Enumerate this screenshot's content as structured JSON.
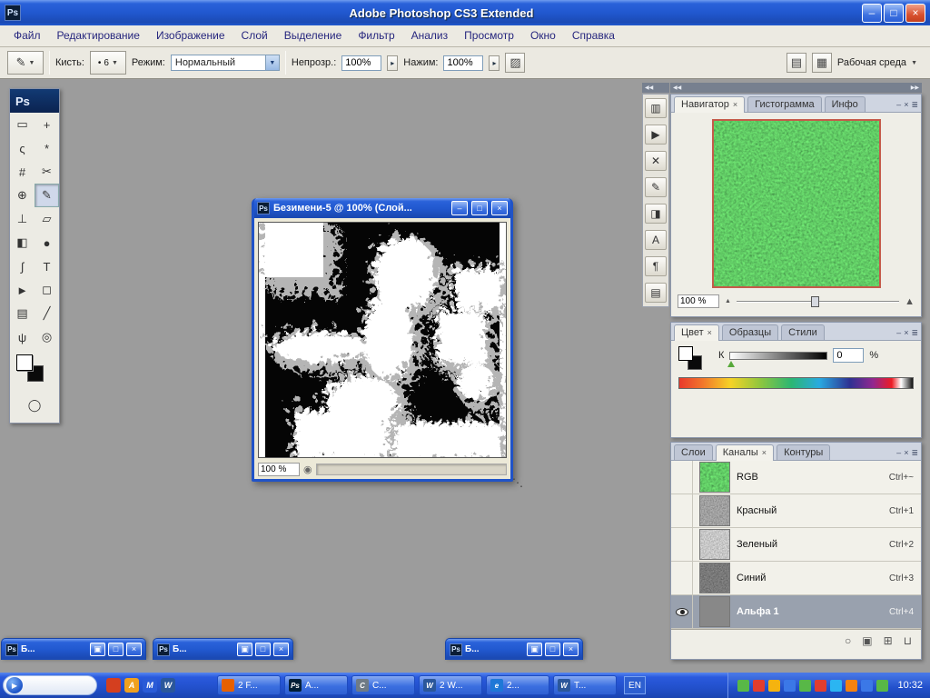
{
  "colors": {
    "titlebar_blue": "#2158cf",
    "taskbar_blue": "#2a5ade",
    "workspace_gray": "#9c9c9c",
    "selected_row_gray": "#99a1ae",
    "navigator_proxy_red": "#c55a4a"
  },
  "icons": {
    "minimize": "‒",
    "maximize": "□",
    "restore": "▣",
    "close": "×",
    "menu": "≣",
    "dropdown": "▼",
    "small_arrow": "▸",
    "chevrons_left": "◀◀",
    "chevrons_right": "▶▶",
    "mountain": "▲",
    "play": "▶",
    "dot": "◉",
    "grip": "⋱"
  },
  "titlebar": {
    "app_icon": "Ps",
    "title": "Adobe Photoshop CS3 Extended"
  },
  "menubar": {
    "items": [
      "Файл",
      "Редактирование",
      "Изображение",
      "Слой",
      "Выделение",
      "Фильтр",
      "Анализ",
      "Просмотр",
      "Окно",
      "Справка"
    ]
  },
  "optionsbar": {
    "tool_icon": "✎",
    "brush_label": "Кисть:",
    "brush_dot": "•",
    "brush_size": "6",
    "mode_label": "Режим:",
    "mode_value": "Нормальный",
    "opacity_label": "Непрозр.:",
    "opacity_value": "100%",
    "flow_label": "Нажим:",
    "flow_value": "100%",
    "airbrush_icon": "▨",
    "palette_icon_1": "▤",
    "palette_icon_2": "▦",
    "workspace_label": "Рабочая среда"
  },
  "toolbox": {
    "header": "Ps",
    "tools": [
      {
        "name": "rectangular-marquee",
        "glyph": "▭"
      },
      {
        "name": "move",
        "glyph": "+"
      },
      {
        "name": "lasso",
        "glyph": "ς"
      },
      {
        "name": "magic-wand",
        "glyph": "*"
      },
      {
        "name": "crop",
        "glyph": "#"
      },
      {
        "name": "slice",
        "glyph": "✂"
      },
      {
        "name": "healing-brush",
        "glyph": "⊕"
      },
      {
        "name": "brush",
        "glyph": "✎"
      },
      {
        "name": "clone-stamp",
        "glyph": "⊥"
      },
      {
        "name": "eraser",
        "glyph": "▱"
      },
      {
        "name": "gradient",
        "glyph": "◧"
      },
      {
        "name": "blur",
        "glyph": "●"
      },
      {
        "name": "pen",
        "glyph": "∫"
      },
      {
        "name": "type",
        "glyph": "T"
      },
      {
        "name": "path-selection",
        "glyph": "►"
      },
      {
        "name": "shape",
        "glyph": "◻"
      },
      {
        "name": "notes",
        "glyph": "▤"
      },
      {
        "name": "eyedropper",
        "glyph": "╱"
      },
      {
        "name": "hand",
        "glyph": "ψ"
      },
      {
        "name": "zoom",
        "glyph": "◎"
      }
    ],
    "quick_mask_glyph": "◯"
  },
  "dock_strip": {
    "icons": [
      {
        "name": "panel-grid",
        "glyph": "▥"
      },
      {
        "name": "panel-play",
        "glyph": "▶"
      },
      {
        "name": "panel-tools",
        "glyph": "✕"
      },
      {
        "name": "panel-brush",
        "glyph": "✎"
      },
      {
        "name": "panel-gradient",
        "glyph": "◨"
      },
      {
        "name": "panel-character",
        "glyph": "А"
      },
      {
        "name": "panel-paragraph",
        "glyph": "¶"
      },
      {
        "name": "panel-notes",
        "glyph": "▤"
      }
    ]
  },
  "document": {
    "icon": "Ps",
    "title": "Безимени-5 @ 100% (Слой...",
    "zoom_value": "100 %"
  },
  "navigator": {
    "tabs": [
      "Навигатор",
      "Гистограмма",
      "Инфо"
    ],
    "zoom_value": "100 %"
  },
  "color": {
    "tabs": [
      "Цвет",
      "Образцы",
      "Стили"
    ],
    "channel_label": "К",
    "value": "0",
    "unit": "%"
  },
  "channels": {
    "tabs": [
      "Слои",
      "Каналы",
      "Контуры"
    ],
    "rows": [
      {
        "name": "RGB",
        "shortcut": "Ctrl+~"
      },
      {
        "name": "Красный",
        "shortcut": "Ctrl+1"
      },
      {
        "name": "Зеленый",
        "shortcut": "Ctrl+2"
      },
      {
        "name": "Синий",
        "shortcut": "Ctrl+3"
      },
      {
        "name": "Альфа 1",
        "shortcut": "Ctrl+4"
      }
    ],
    "footer_icons": [
      {
        "name": "load-selection",
        "glyph": "○"
      },
      {
        "name": "save-selection",
        "glyph": "▣"
      },
      {
        "name": "new-channel",
        "glyph": "⊞"
      },
      {
        "name": "delete-channel",
        "glyph": "⊔"
      }
    ]
  },
  "minimized_windows": [
    {
      "icon": "Ps",
      "title": "Б..."
    },
    {
      "icon": "Ps",
      "title": "Б..."
    },
    {
      "icon": "Ps",
      "title": "Б..."
    }
  ],
  "taskbar": {
    "quick_launch": [
      {
        "name": "quick-launch-1",
        "color": "#d43f1f",
        "label": ""
      },
      {
        "name": "quick-launch-2",
        "color": "#f0a11e",
        "label": "A"
      },
      {
        "name": "quick-launch-3",
        "color": "#2a5bd7",
        "label": "M"
      },
      {
        "name": "quick-launch-4",
        "color": "#2b579a",
        "label": "W"
      }
    ],
    "tasks": [
      {
        "label": "2 F...",
        "icon_color": "#e66000",
        "icon_text": ""
      },
      {
        "label": "A...",
        "icon_color": "#001e36",
        "icon_text": "Ps"
      },
      {
        "label": "C...",
        "icon_color": "#6f7b86",
        "icon_text": "C"
      },
      {
        "label": "2 W...",
        "icon_color": "#2b579a",
        "icon_text": "W"
      },
      {
        "label": "2...",
        "icon_color": "#1e78d7",
        "icon_text": "e"
      },
      {
        "label": "T...",
        "icon_color": "#2b579a",
        "icon_text": "W"
      }
    ],
    "language": "EN",
    "tray_colors": [
      "#58b847",
      "#e23d2e",
      "#f5b30f",
      "#3b78e7",
      "#58b847",
      "#e23d2e",
      "#2bb5f2",
      "#f5820f",
      "#3b78e7",
      "#58b847"
    ],
    "clock": "10:32"
  }
}
